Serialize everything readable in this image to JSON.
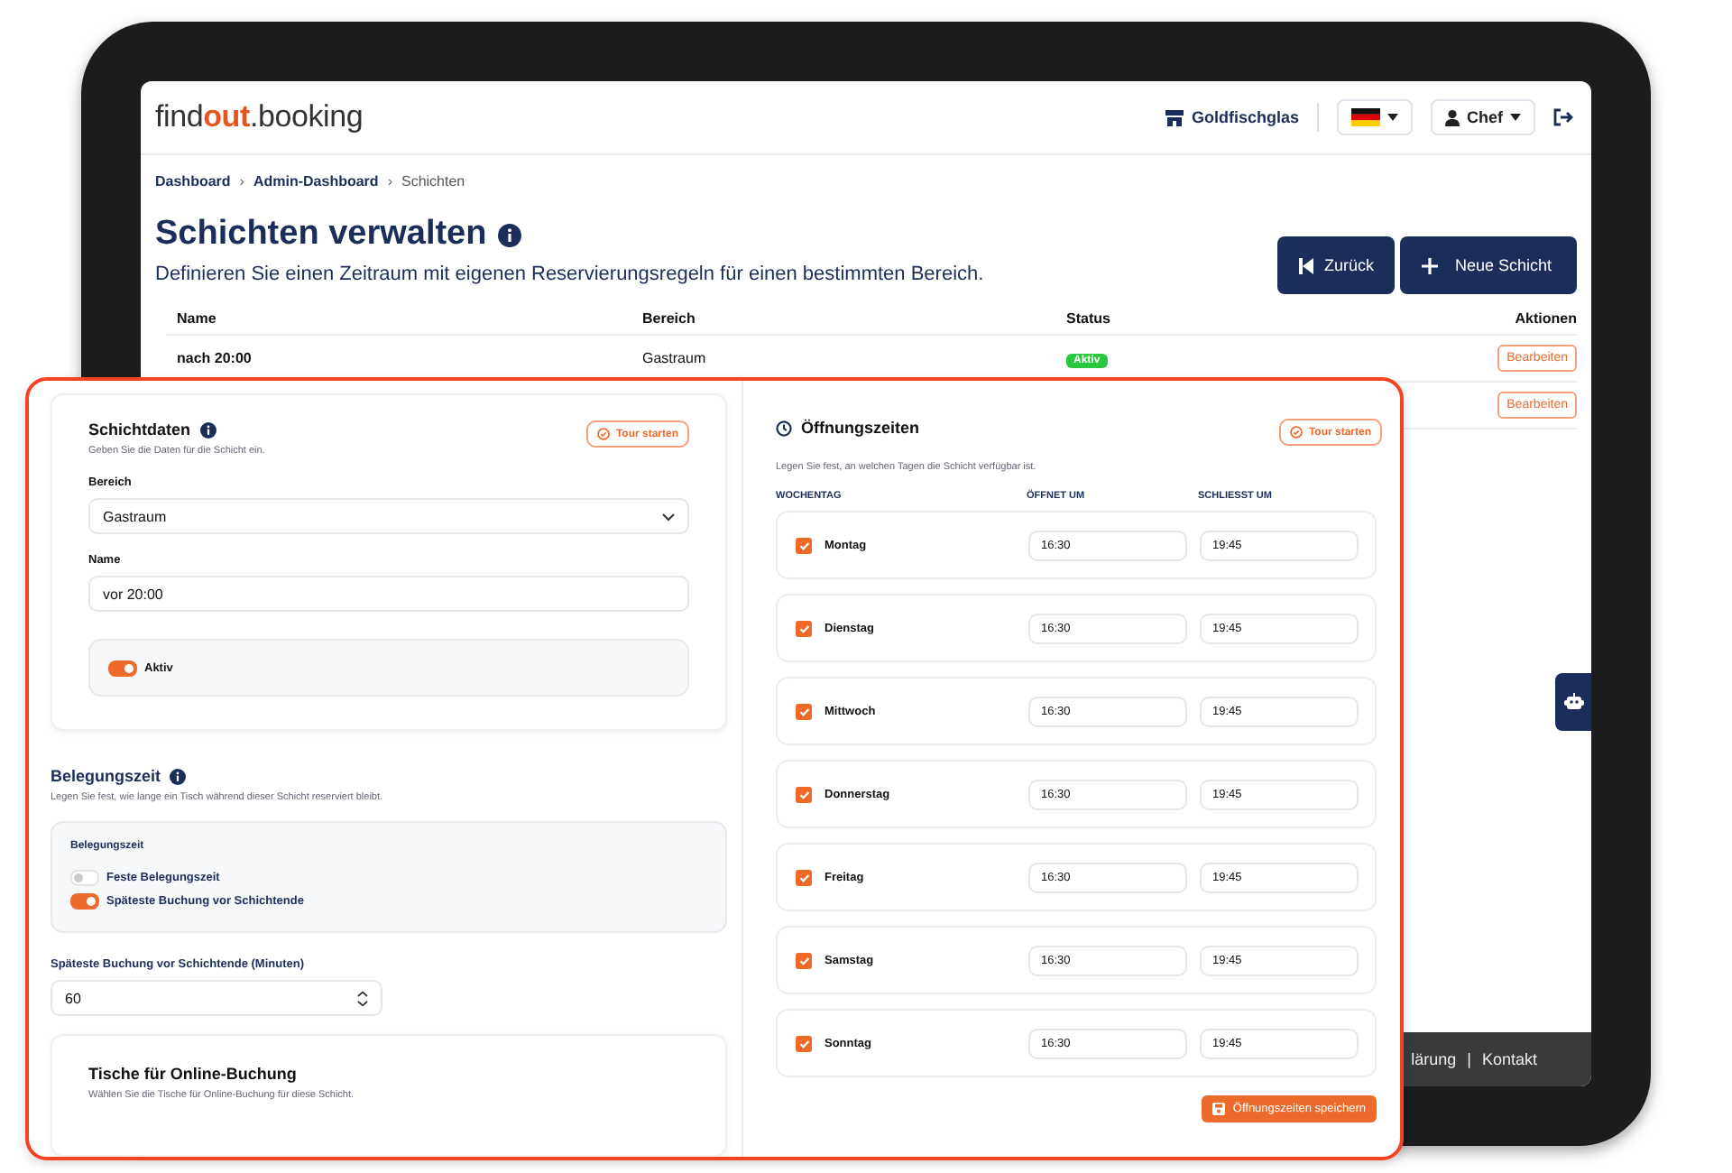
{
  "header": {
    "logo": {
      "lead": "find",
      "accent": "out",
      "tail": ".booking"
    },
    "venue": "Goldfischglas",
    "user": "Chef"
  },
  "breadcrumbs": [
    {
      "label": "Dashboard",
      "current": false
    },
    {
      "label": "Admin-Dashboard",
      "current": false
    },
    {
      "label": "Schichten",
      "current": true
    }
  ],
  "breadcrumb_separators": [
    "›",
    "›"
  ],
  "page": {
    "title": "Schichten verwalten",
    "subtitle": "Definieren Sie einen Zeitraum mit eigenen Reservierungsregeln für einen bestimmten Bereich.",
    "buttons": [
      {
        "label": "Zurück",
        "kind": "back"
      },
      {
        "label": "Neue Schicht",
        "kind": "new"
      }
    ]
  },
  "table": {
    "columns": [
      "Name",
      "Bereich",
      "Status",
      "Aktionen"
    ],
    "rows": [
      {
        "name": "nach 20:00",
        "area": "Gastraum",
        "status": "Aktiv",
        "action": "Bearbeiten"
      },
      {
        "action": "Bearbeiten"
      }
    ]
  },
  "footer": {
    "links": [
      "lärung",
      "Kontakt"
    ],
    "separator": "|"
  },
  "shift_form": {
    "title": "Schichtdaten",
    "hint": "Geben Sie die Daten für die Schicht ein.",
    "tour_button": "Tour starten",
    "fields": [
      {
        "label": "Bereich",
        "value": "Gastraum",
        "kind": "select"
      },
      {
        "label": "Name",
        "value": "vor 20:00",
        "kind": "text"
      }
    ],
    "active_toggle": {
      "label": "Aktiv",
      "on": true
    }
  },
  "occupancy": {
    "title": "Belegungszeit",
    "hint": "Legen Sie fest, wie lange ein Tisch während dieser Schicht reserviert bleibt.",
    "box_title": "Belegungszeit",
    "options": [
      {
        "label": "Feste Belegungszeit",
        "on": false
      },
      {
        "label": "Späteste Buchung vor Schichtende",
        "on": true
      }
    ],
    "minutes_label": "Späteste Buchung vor Schichtende (Minuten)",
    "minutes_value": "60"
  },
  "tables": {
    "title": "Tische für Online-Buchung",
    "hint": "Wählen Sie die Tische für Online-Buchung für diese Schicht."
  },
  "hours": {
    "title": "Öffnungszeiten",
    "tour_button": "Tour starten",
    "hint": "Legen Sie fest, an welchen Tagen die Schicht verfügbar ist.",
    "columns": [
      "WOCHENTAG",
      "ÖFFNET UM",
      "SCHLIESST UM"
    ],
    "days": [
      {
        "day": "Montag",
        "checked": true,
        "opens": "16:30",
        "closes": "19:45"
      },
      {
        "day": "Dienstag",
        "checked": true,
        "opens": "16:30",
        "closes": "19:45"
      },
      {
        "day": "Mittwoch",
        "checked": true,
        "opens": "16:30",
        "closes": "19:45"
      },
      {
        "day": "Donnerstag",
        "checked": true,
        "opens": "16:30",
        "closes": "19:45"
      },
      {
        "day": "Freitag",
        "checked": true,
        "opens": "16:30",
        "closes": "19:45"
      },
      {
        "day": "Samstag",
        "checked": true,
        "opens": "16:30",
        "closes": "19:45"
      },
      {
        "day": "Sonntag",
        "checked": true,
        "opens": "16:30",
        "closes": "19:45"
      }
    ],
    "save_button": "Öffnungszeiten speichern"
  }
}
